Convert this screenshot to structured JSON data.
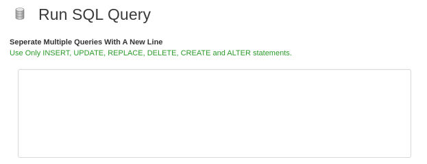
{
  "header": {
    "icon": "database-icon",
    "title": "Run SQL Query"
  },
  "instructions": {
    "main": "Seperate Multiple Queries With A New Line",
    "note": "Use Only INSERT, UPDATE, REPLACE, DELETE, CREATE and ALTER statements.",
    "note_color": "#2a9a2a"
  },
  "query": {
    "value": ""
  }
}
